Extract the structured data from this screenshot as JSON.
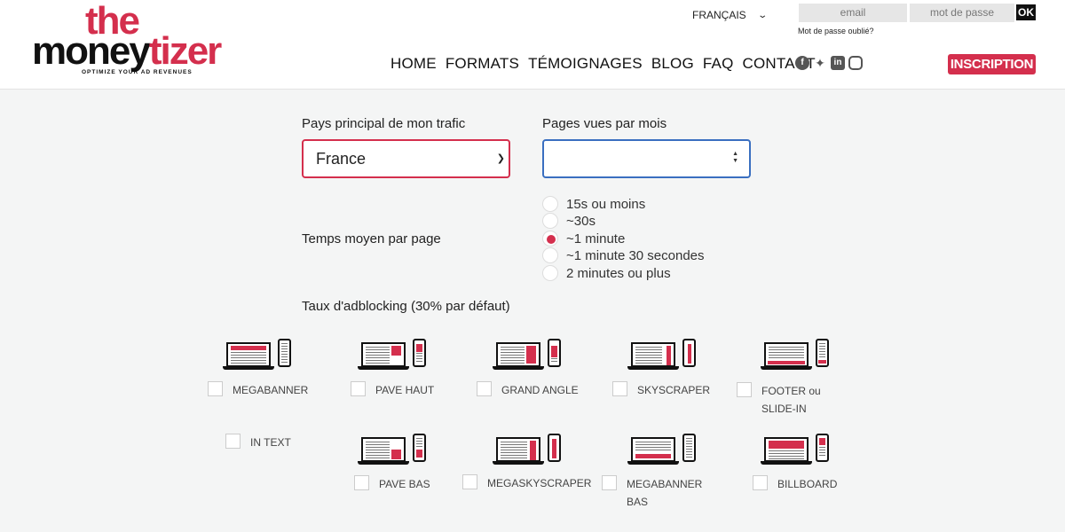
{
  "header": {
    "logo_the": "the",
    "logo_money": "money",
    "logo_tizer": "tizer",
    "logo_tag": "OPTIMIZE YOUR AD REVENUES",
    "language": "FRANÇAIS",
    "email_placeholder": "email",
    "password_placeholder": "mot de passe",
    "ok_label": "OK",
    "forgot_password": "Mot de passe oublié?",
    "nav": [
      "HOME",
      "FORMATS",
      "TÉMOIGNAGES",
      "BLOG",
      "FAQ",
      "CONTACT"
    ],
    "social_icons": [
      "facebook-icon",
      "twitter-icon",
      "linkedin-icon",
      "instagram-icon"
    ],
    "inscription_label": "INSCRIPTION"
  },
  "form": {
    "country_label": "Pays principal de mon trafic",
    "country_value": "France",
    "pageviews_label": "Pages vues par mois",
    "pageviews_value": "",
    "time_label": "Temps moyen par page",
    "time_options": [
      "15s ou moins",
      "~30s",
      "~1 minute",
      "~1 minute 30 secondes",
      "2 minutes ou plus"
    ],
    "time_selected": "~1 minute",
    "adblock_label": "Taux d'adblocking (30% par défaut)"
  },
  "formats": {
    "megabanner": "MEGABANNER",
    "pave_haut": "PAVE HAUT",
    "grand_angle": "GRAND ANGLE",
    "skyscraper": "SKYSCRAPER",
    "footer_line1": "FOOTER ou",
    "footer_line2": "SLIDE-IN",
    "in_text": "IN TEXT",
    "pave_bas": "PAVE BAS",
    "megaskyscraper": "MEGASKYSCRAPER",
    "megabanner_bas_line1": "MEGABANNER",
    "megabanner_bas_line2": "BAS",
    "billboard": "BILLBOARD"
  },
  "colors": {
    "accent": "#d42f4d",
    "focus": "#3a6fc0"
  }
}
